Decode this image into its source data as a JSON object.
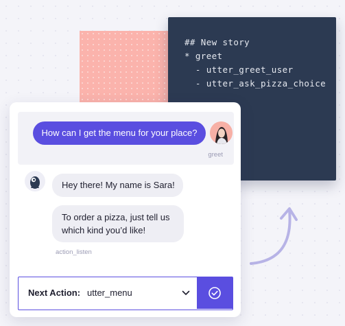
{
  "code_block": {
    "lines": [
      "## New story",
      "* greet",
      "  - utter_greet_user",
      "  - utter_ask_pizza_choice"
    ]
  },
  "chat": {
    "user_message": "How can I get the menu for your place?",
    "intent_label": "greet",
    "bot_messages": [
      "Hey there! My name is Sara!",
      "To order a pizza, just tell us which kind you’d like!"
    ],
    "action_label": "action_listen"
  },
  "next_action": {
    "prefix": "Next Action:",
    "value": "utter_menu"
  },
  "icons": {
    "dropdown": "chevron-down-icon",
    "confirm": "check-circle-icon",
    "bot": "bot-avatar-icon",
    "user": "user-avatar"
  },
  "colors": {
    "accent": "#5a4ee0",
    "code_bg": "#2c3a52",
    "pink": "#fbb3ac",
    "arrow": "#b7b3e6"
  }
}
